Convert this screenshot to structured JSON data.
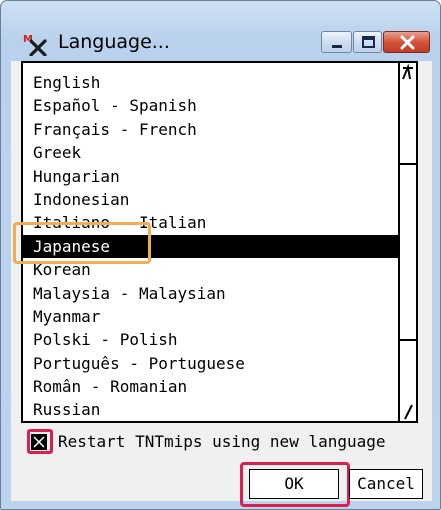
{
  "window": {
    "title": "Language...",
    "icons": {
      "app": "tntmips-app-icon",
      "minimize": "minimize-icon",
      "maximize": "maximize-icon",
      "close": "close-icon"
    }
  },
  "language_list": {
    "items": [
      "English",
      "Español - Spanish",
      "Français - French",
      "Greek",
      "Hungarian",
      "Indonesian",
      "Italiano - Italian",
      "Japanese",
      "Korean",
      "Malaysia - Malaysian",
      "Myanmar",
      "Polski - Polish",
      "Português - Portuguese",
      "Român - Romanian",
      "Russian"
    ],
    "selected": "Japanese"
  },
  "restart_option": {
    "label": "Restart TNTmips using new language",
    "checked": true
  },
  "buttons": {
    "ok_label": "OK",
    "cancel_label": "Cancel"
  },
  "colors": {
    "selection_bg": "#000000",
    "annotation_orange": "#f2ad52",
    "annotation_red": "#d9204e"
  }
}
